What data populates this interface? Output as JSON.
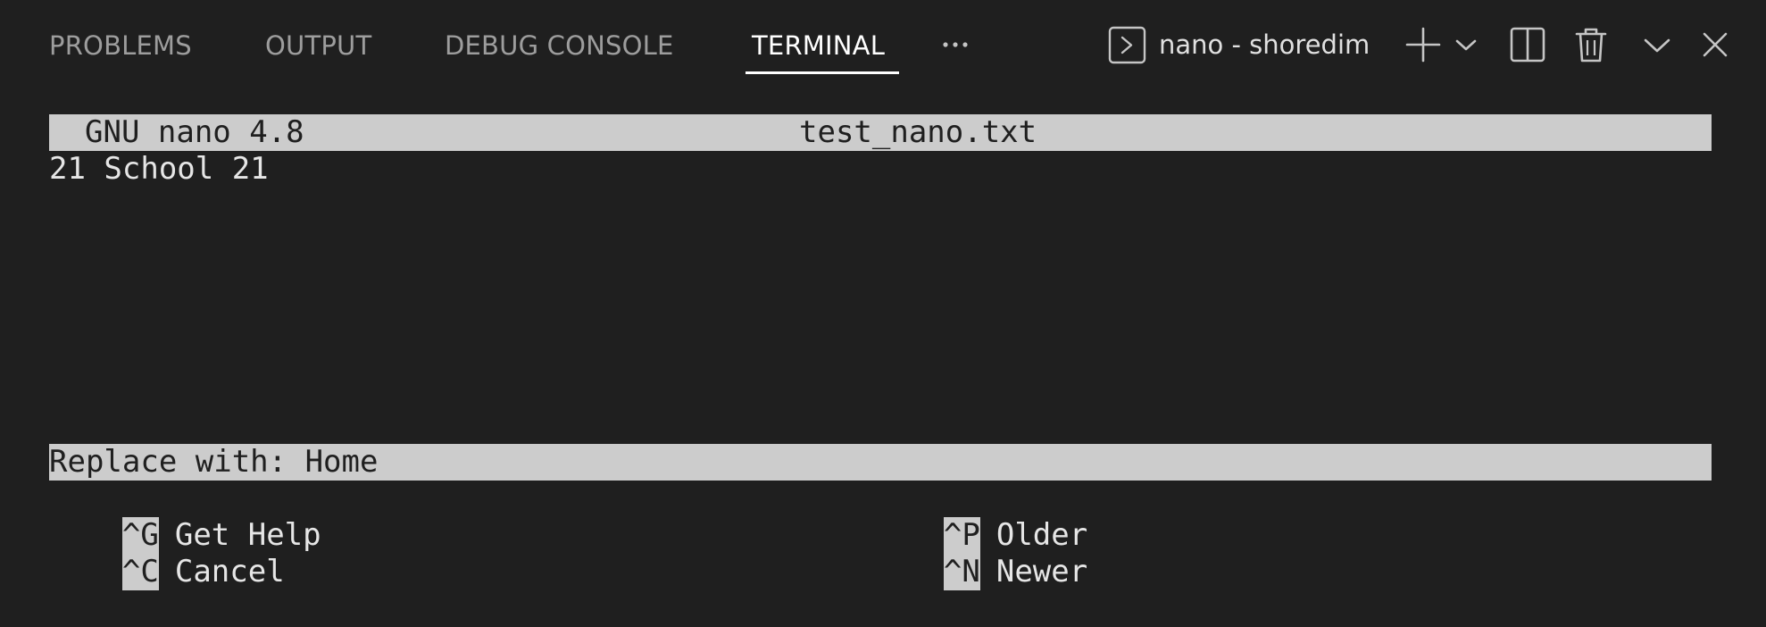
{
  "panel": {
    "tabs": [
      {
        "label": "PROBLEMS",
        "active": false
      },
      {
        "label": "OUTPUT",
        "active": false
      },
      {
        "label": "DEBUG CONSOLE",
        "active": false
      },
      {
        "label": "TERMINAL",
        "active": true
      }
    ],
    "more_icon": "ellipsis-icon",
    "terminal_name": "nano - shoredim",
    "actions": [
      {
        "name": "new-terminal-icon"
      },
      {
        "name": "chevron-down-icon"
      },
      {
        "name": "split-terminal-icon"
      },
      {
        "name": "trash-icon"
      },
      {
        "name": "maximize-panel-icon"
      },
      {
        "name": "close-icon"
      }
    ]
  },
  "nano": {
    "version": "GNU nano 4.8",
    "filename": "test_nano.txt",
    "content": "21 School 21",
    "prompt": "Replace with: Home",
    "shortcuts": [
      {
        "key": "^G",
        "label": "Get Help"
      },
      {
        "key": "^P",
        "label": "Older"
      },
      {
        "key": "^C",
        "label": "Cancel"
      },
      {
        "key": "^N",
        "label": "Newer"
      }
    ]
  },
  "colors": {
    "background": "#1f1f1f",
    "inverse_bar": "#cccccc",
    "active_tab": "#ffffff",
    "inactive_tab": "#9d9d9d"
  }
}
